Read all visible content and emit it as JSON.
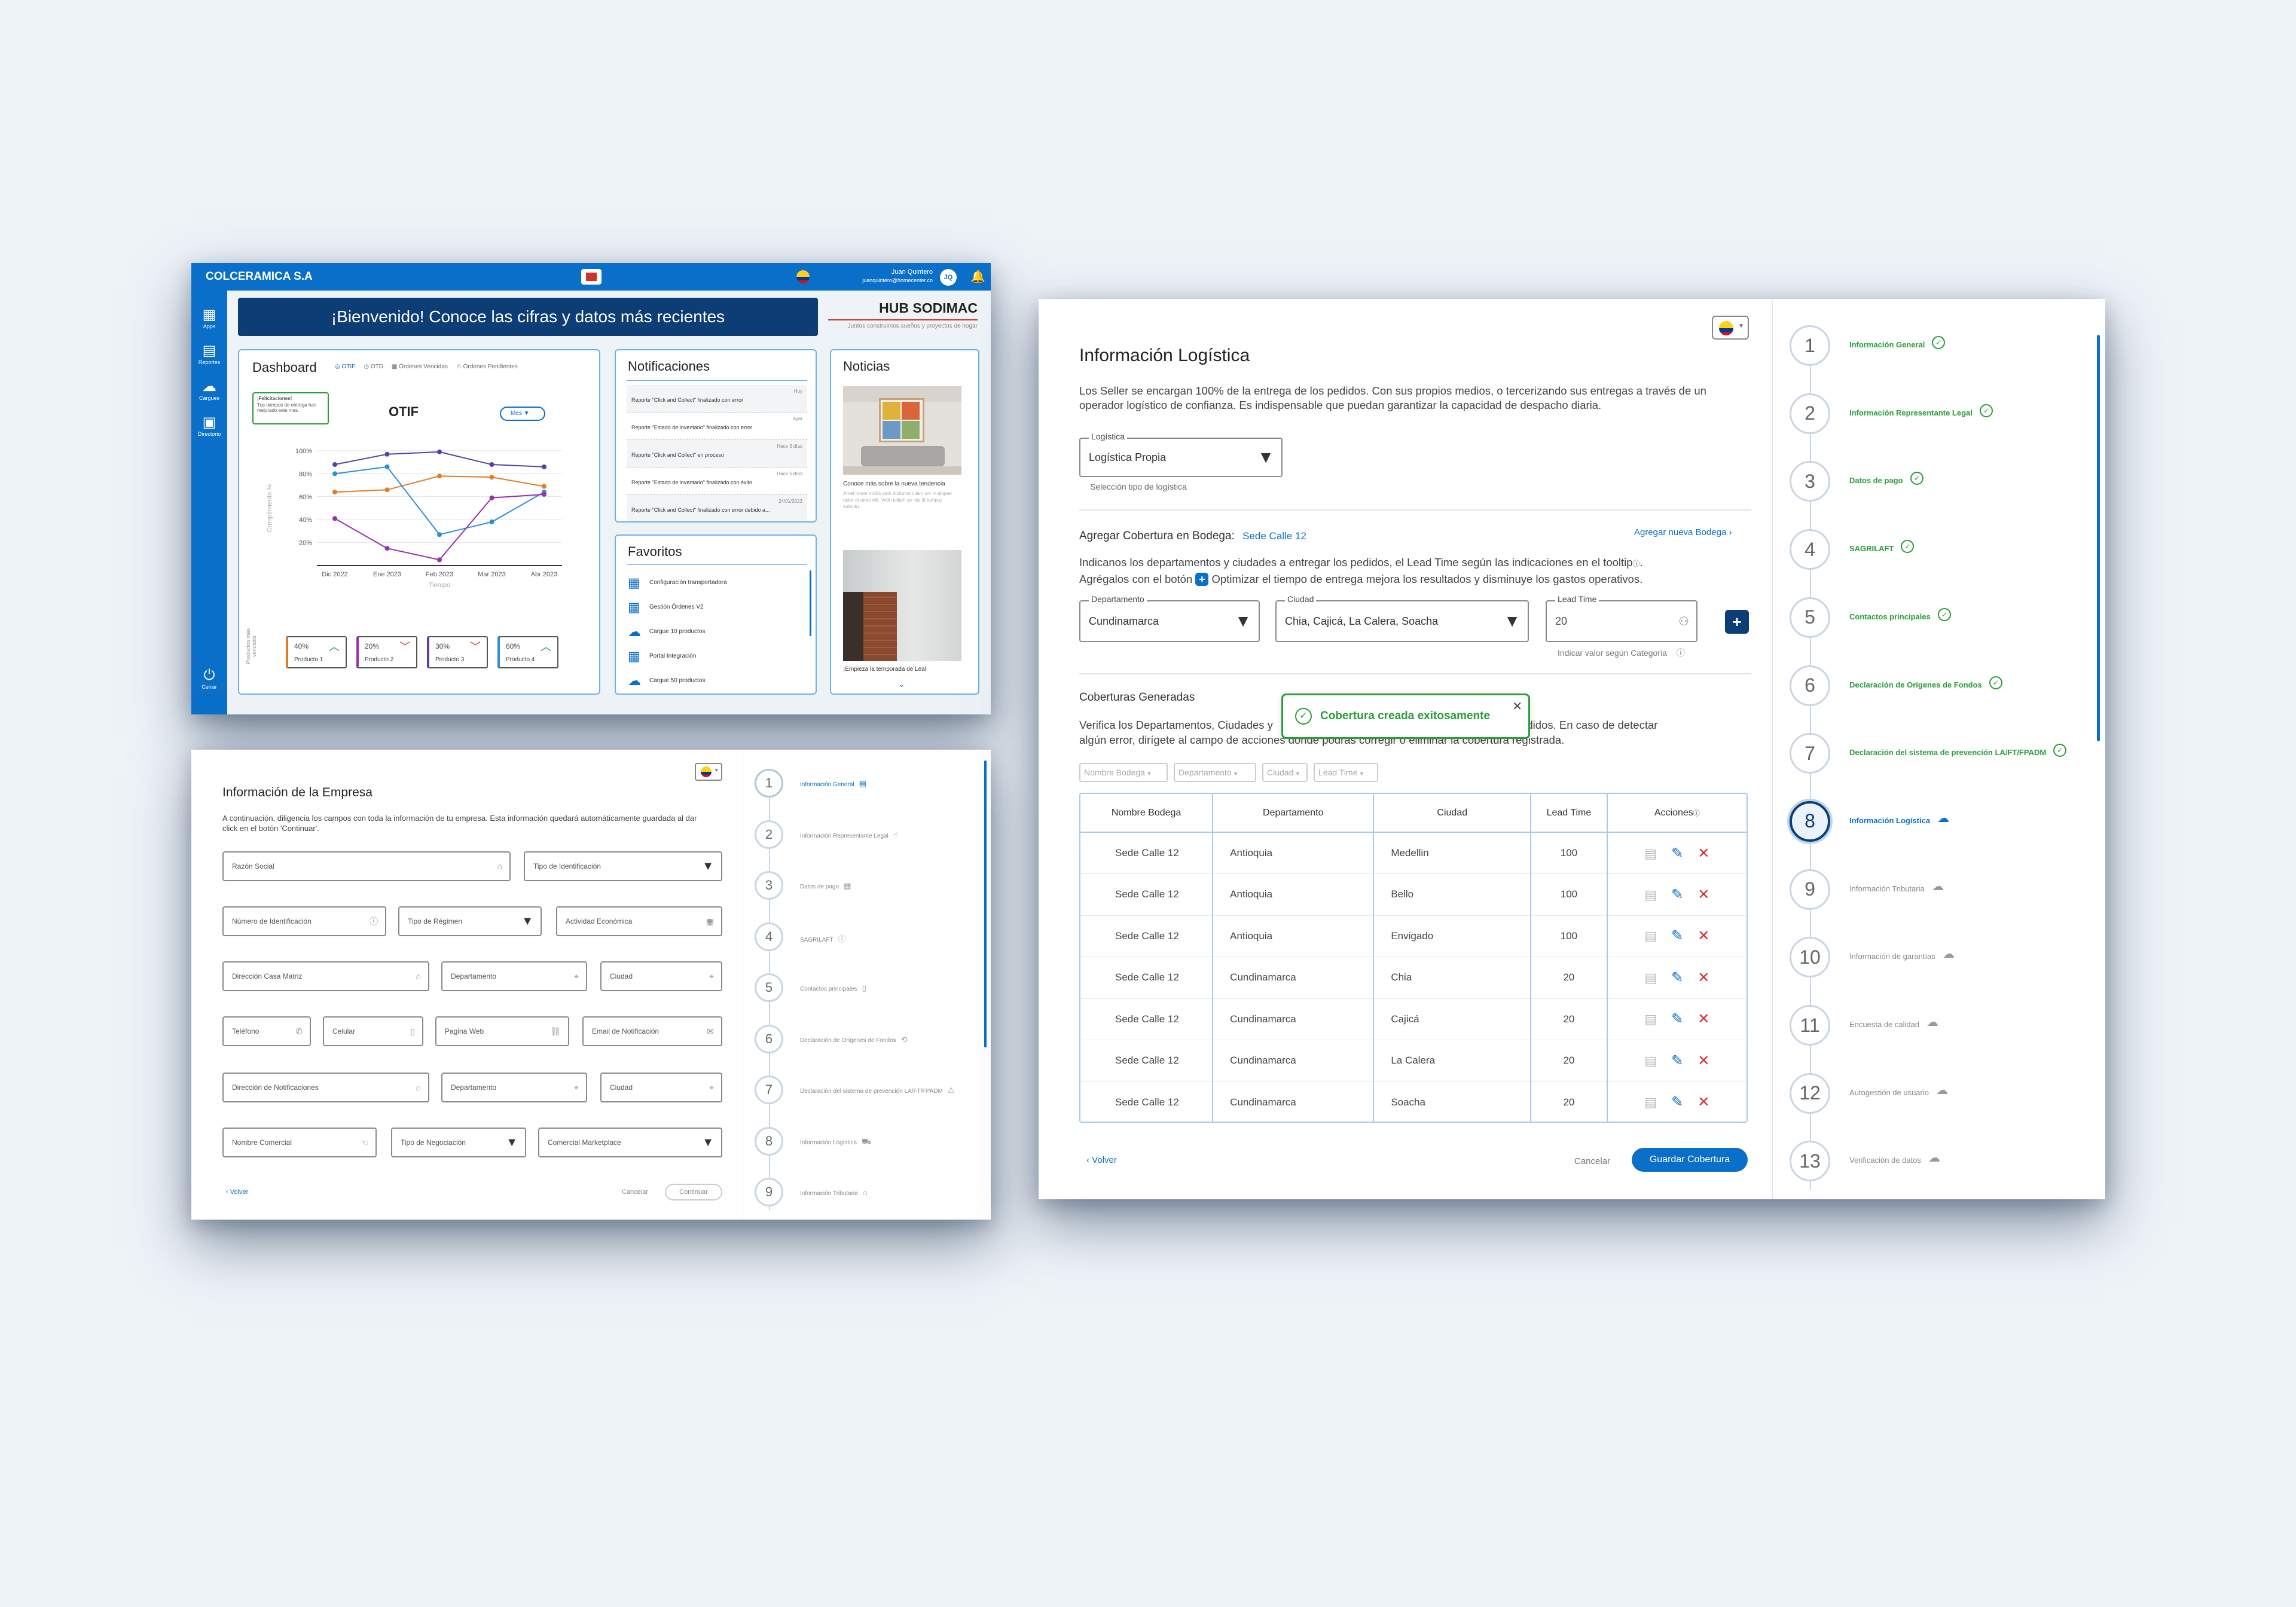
{
  "dashboard": {
    "company": "COLCERAMICA S.A",
    "user_name": "Juan Quintero",
    "user_email": "juanquintero@homecenter.co",
    "user_initials": "JQ",
    "sidebar": [
      {
        "label": "Apps"
      },
      {
        "label": "Reportes"
      },
      {
        "label": "Cargues"
      },
      {
        "label": "Directorio"
      }
    ],
    "logout_label": "Cerrar",
    "welcome": "¡Bienvenido! Conoce las cifras y datos más recientes",
    "hub_title": "HUB SODIMAC",
    "hub_subtitle": "Juntos construimos sueños y proyectos de hogar",
    "dash_title": "Dashboard",
    "filters": [
      "OTIF",
      "OTD",
      "Órdenes Vencidas",
      "Órdenes Pendientes"
    ],
    "congrats_title": "¡Felicitaciones!",
    "congrats_text": "Tus tiempos de entrega han mejorado este mes.",
    "chart_title": "OTIF",
    "period_select": "Mes",
    "ylabel": "Cumplimiento %",
    "xlabel": "Tiempo",
    "products_label": "Productos más vendidos",
    "kpis": [
      {
        "value": "40%",
        "name": "Producto 1",
        "trend": "up",
        "color": "#e07b2a"
      },
      {
        "value": "20%",
        "name": "Producto 2",
        "trend": "down",
        "color": "#9b2fae"
      },
      {
        "value": "30%",
        "name": "Producto 3",
        "trend": "down",
        "color": "#5b3fa8"
      },
      {
        "value": "60%",
        "name": "Producto 4",
        "trend": "up",
        "color": "#2a8fd6"
      }
    ],
    "notif_title": "Notificaciones",
    "notifications": [
      {
        "text": "Reporte \"Click and Collect\" finalizado con error",
        "time": "Hoy"
      },
      {
        "text": "Reporte \"Estado de inventario\" finalizado con error",
        "time": "Ayer"
      },
      {
        "text": "Reporte \"Click and Collect\" en proceso",
        "time": "Hace 3 días"
      },
      {
        "text": "Reporte \"Estado de inventario\" finalizado con éxito",
        "time": "Hace 5 días"
      },
      {
        "text": "Reporte \"Click and Collect\" finalizado con error debido a...",
        "time": "24/01/2023"
      }
    ],
    "fav_title": "Favoritos",
    "favorites": [
      "Configuración transportadora",
      "Gestión Órdenes V2",
      "Cargue 10 productos",
      "Portal Integración",
      "Cargue 50 productos"
    ],
    "news_title": "Noticias",
    "news1_title": "Conoce más sobre la nueva tendencia",
    "news1_text": "Amet lorem mollis sem dictumst ullam cor in aliquet dolor at amet elit. Velit nullam ac nisi id tempus sollicitu...",
    "news2_title": "¡Empieza la temporada de Leal"
  },
  "chart_data": {
    "type": "line",
    "title": "OTIF",
    "xlabel": "Tiempo",
    "ylabel": "Cumplimiento %",
    "categories": [
      "Dic 2022",
      "Ene 2023",
      "Feb 2023",
      "Mar 2023",
      "Abr 2023"
    ],
    "yticks": [
      "20%",
      "40%",
      "60%",
      "80%",
      "100%"
    ],
    "ylim": [
      0,
      100
    ],
    "grid": true,
    "series": [
      {
        "color": "#5b3fa8",
        "values": [
          88,
          97,
          99,
          88,
          86
        ]
      },
      {
        "color": "#e07b2a",
        "values": [
          64,
          66,
          78,
          77,
          69
        ]
      },
      {
        "color": "#2a8fd6",
        "values": [
          80,
          86,
          27,
          38,
          64
        ]
      },
      {
        "color": "#9b2fae",
        "values": [
          41,
          15,
          5,
          59,
          62
        ]
      }
    ]
  },
  "empresa": {
    "title": "Información de la Empresa",
    "intro": "A continuación, diligencia los campos con toda la información de tu empresa. Esta información quedará automáticamente guardada al dar click en el botón 'Continuar'.",
    "fields": {
      "razon": "Razón Social",
      "tipo_id": "Tipo de Identificación",
      "num_id": "Número de Identificación",
      "regimen": "Tipo de Régimen",
      "actividad": "Actividad Económica",
      "direccion": "Dirección Casa Matriz",
      "depto": "Departamento",
      "ciudad": "Ciudad",
      "telefono": "Teléfono",
      "celular": "Celular",
      "web": "Pagina Web",
      "email": "Email de Notificación",
      "dir_notif": "Dirección de Notificaciones",
      "depto2": "Departamento",
      "ciudad2": "Ciudad",
      "comercial": "Nombre Comercial",
      "negociacion": "Tipo de Negociación",
      "marketplace": "Comercial Marketplace"
    },
    "back": "Volver",
    "cancel": "Cancelar",
    "continue": "Continuar",
    "steps": [
      "Información General",
      "Información Representante Legal",
      "Datos de pago",
      "SAGRILAFT",
      "Contactos principales",
      "Declaración de Orígenes de Fondos",
      "Declaración del sistema de prevención LA/FT/FPADM",
      "Información Logística",
      "Información Tributaria"
    ]
  },
  "logistica": {
    "title": "Información Logística",
    "intro": "Los Seller se encargan 100% de la entrega de los pedidos. Con sus propios medios, o tercerizando sus entregas a través de un operador logístico de confianza. Es indispensable que puedan garantizar la capacidad de despacho diaria.",
    "logistica_label": "Logística",
    "logistica_value": "Logística Propia",
    "logistica_help": "Selección tipo de logística",
    "cobertura_label": "Agregar Cobertura en Bodega:",
    "cobertura_bodega": "Sede Calle 12",
    "nueva_bodega": "Agregar nueva Bodega",
    "instr1": "Indicanos los departamentos y ciudades a entregar los pedidos, el Lead Time según las indicaciones en el tooltip",
    "instr2a": "Agrégalos con el botón",
    "instr2b": "Optimizar el tiempo de entrega mejora los resultados y disminuye los gastos operativos.",
    "depto_label": "Departamento",
    "depto_value": "Cundinamarca",
    "ciudad_label": "Ciudad",
    "ciudad_value": "Chia, Cajicá, La Calera, Soacha",
    "lead_label": "Lead Time",
    "lead_value": "20",
    "lead_help": "Indicar valor según Categoria",
    "generadas_title": "Coberturas Generadas",
    "generadas_text1": "Verifica los Departamentos, Ciudades y",
    "generadas_text1b": "gar pedidos. En caso de detectar",
    "generadas_text2": "algún error, dirígete al campo de acciones donde podrás corregir o eliminar la cobertura registrada.",
    "toast": "Cobertura creada exitosamente",
    "filters": [
      "Nombre Bodega",
      "Departamento",
      "Ciudad",
      "Lead Time"
    ],
    "headers": [
      "Nombre Bodega",
      "Departamento",
      "Ciudad",
      "Lead Time",
      "Acciones"
    ],
    "rows": [
      [
        "Sede Calle 12",
        "Antioquia",
        "Medellin",
        "100"
      ],
      [
        "Sede Calle 12",
        "Antioquia",
        "Bello",
        "100"
      ],
      [
        "Sede Calle 12",
        "Antioquia",
        "Envigado",
        "100"
      ],
      [
        "Sede Calle 12",
        "Cundinamarca",
        "Chia",
        "20"
      ],
      [
        "Sede Calle 12",
        "Cundinamarca",
        "Cajicá",
        "20"
      ],
      [
        "Sede Calle 12",
        "Cundinamarca",
        "La Calera",
        "20"
      ],
      [
        "Sede Calle 12",
        "Cundinamarca",
        "Soacha",
        "20"
      ]
    ],
    "back": "Volver",
    "cancel": "Cancelar",
    "save": "Guardar Cobertura",
    "steps": [
      {
        "label": "Información General",
        "state": "done"
      },
      {
        "label": "Información Representante Legal",
        "state": "done"
      },
      {
        "label": "Datos de pago",
        "state": "done"
      },
      {
        "label": "SAGRILAFT",
        "state": "done"
      },
      {
        "label": "Contactos principales",
        "state": "done"
      },
      {
        "label": "Declaración de Orígenes de Fondos",
        "state": "done"
      },
      {
        "label": "Declaración del sistema de prevención LA/FT/FPADM",
        "state": "done"
      },
      {
        "label": "Información Logística",
        "state": "active"
      },
      {
        "label": "Información Tributaria",
        "state": "pending"
      },
      {
        "label": "Información de garantías",
        "state": "pending"
      },
      {
        "label": "Encuesta de calidad",
        "state": "pending"
      },
      {
        "label": "Autogestión de usuario",
        "state": "pending"
      },
      {
        "label": "Verificación de datos",
        "state": "pending"
      }
    ]
  }
}
